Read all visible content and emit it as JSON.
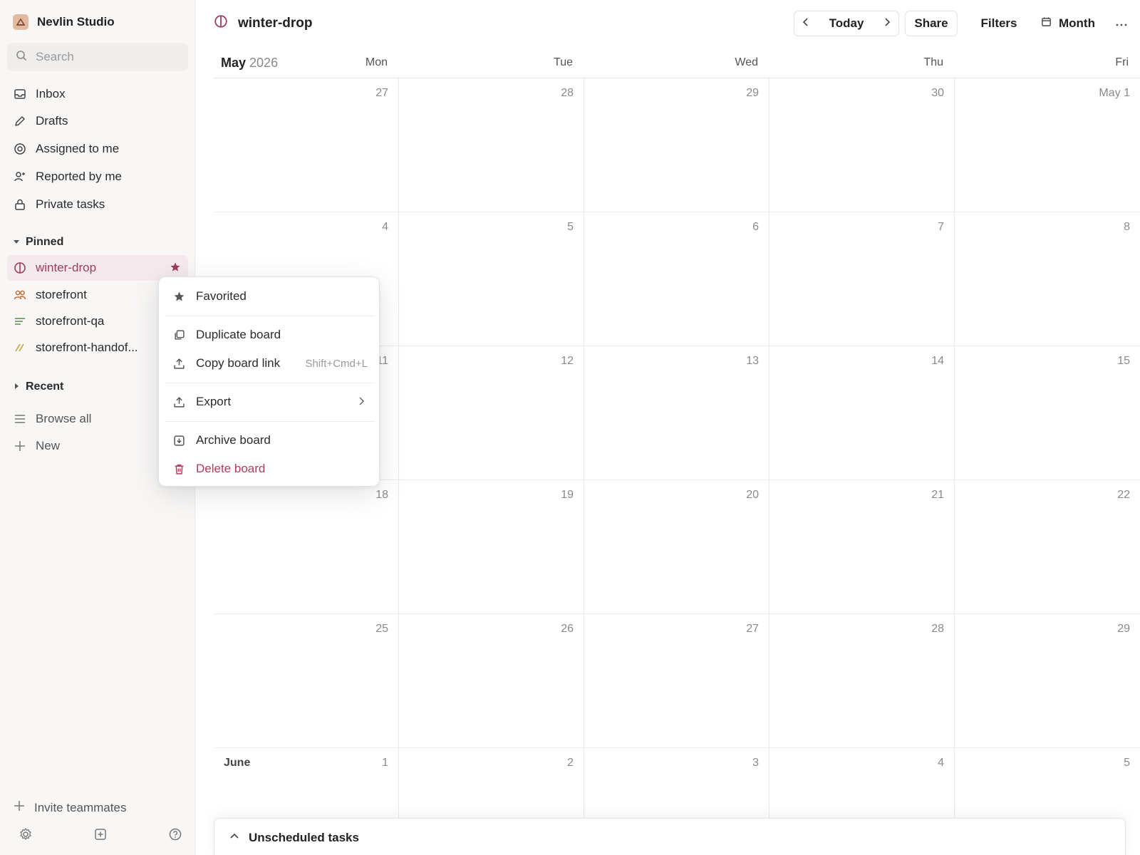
{
  "workspace": {
    "name": "Nevlin Studio"
  },
  "search": {
    "placeholder": "Search"
  },
  "nav": [
    {
      "label": "Inbox",
      "icon": "inbox-icon"
    },
    {
      "label": "Drafts",
      "icon": "pencil-icon"
    },
    {
      "label": "Assigned to me",
      "icon": "target-icon"
    },
    {
      "label": "Reported by me",
      "icon": "user-plus-icon"
    },
    {
      "label": "Private tasks",
      "icon": "lock-icon"
    }
  ],
  "pinned": {
    "heading": "Pinned",
    "items": [
      {
        "label": "winter-drop",
        "icon": "board-circle-icon",
        "active": true
      },
      {
        "label": "storefront",
        "icon": "users-icon"
      },
      {
        "label": "storefront-qa",
        "icon": "list-icon"
      },
      {
        "label": "storefront-handof...",
        "icon": "slashes-icon"
      }
    ]
  },
  "recent": {
    "heading": "Recent"
  },
  "extra": [
    {
      "label": "Browse all",
      "icon": "menu-lines-icon"
    },
    {
      "label": "New",
      "icon": "plus-icon"
    }
  ],
  "footer": {
    "invite": "Invite teammates"
  },
  "board": {
    "title": "winter-drop"
  },
  "toolbar": {
    "today": "Today",
    "share": "Share",
    "filters": "Filters",
    "view": "Month"
  },
  "calendar": {
    "month": "May",
    "year": "2026",
    "days_of_week": [
      "Mon",
      "Tue",
      "Wed",
      "Thu",
      "Fri"
    ],
    "weeks": [
      [
        "27",
        "28",
        "29",
        "30",
        "May 1"
      ],
      [
        "4",
        "5",
        "6",
        "7",
        "8"
      ],
      [
        "11",
        "12",
        "13",
        "14",
        "15"
      ],
      [
        "18",
        "19",
        "20",
        "21",
        "22"
      ],
      [
        "25",
        "26",
        "27",
        "28",
        "29"
      ],
      [
        "1",
        "2",
        "3",
        "4",
        "5"
      ]
    ],
    "next_month_label": "June"
  },
  "unscheduled": {
    "label": "Unscheduled tasks"
  },
  "context_menu": {
    "favorited": "Favorited",
    "duplicate": "Duplicate board",
    "copy_link": "Copy board link",
    "copy_link_shortcut": "Shift+Cmd+L",
    "export": "Export",
    "archive": "Archive board",
    "delete": "Delete board"
  },
  "colors": {
    "accent": "#9c3d5c",
    "danger": "#b23a5c",
    "sidebar_bg": "#f8f7f6"
  }
}
